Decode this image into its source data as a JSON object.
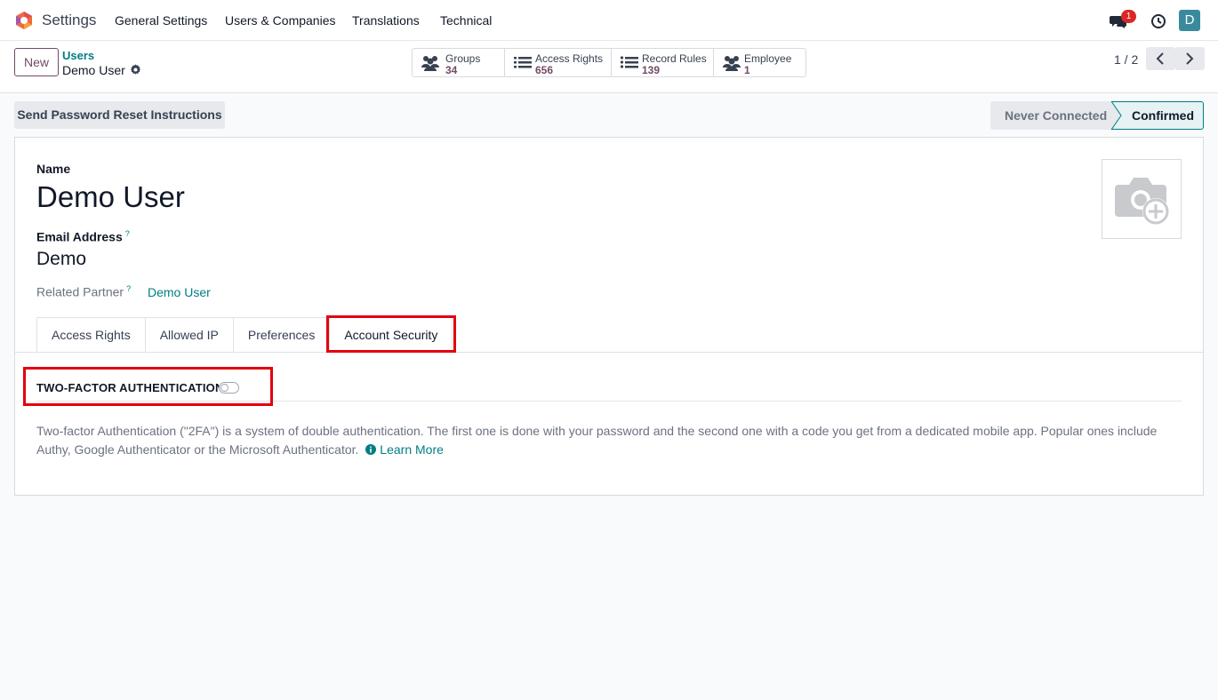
{
  "navbar": {
    "app_title": "Settings",
    "menu": [
      "General Settings",
      "Users & Companies",
      "Translations",
      "Technical"
    ],
    "notification_count": "1",
    "avatar_letter": "D"
  },
  "control_panel": {
    "new_label": "New",
    "breadcrumb_parent": "Users",
    "breadcrumb_current": "Demo User",
    "smart_buttons": [
      {
        "label": "Groups",
        "value": "34",
        "icon": "users-icon"
      },
      {
        "label": "Access Rights",
        "value": "656",
        "icon": "list-icon"
      },
      {
        "label": "Record Rules",
        "value": "139",
        "icon": "list-icon"
      },
      {
        "label": "Employee",
        "value": "1",
        "icon": "users-icon"
      }
    ],
    "pager": "1 / 2"
  },
  "statusbar": {
    "reset_button": "Send Password Reset Instructions",
    "stages": [
      "Never Connected",
      "Confirmed"
    ],
    "active_stage": "Confirmed"
  },
  "form": {
    "name_label": "Name",
    "name_value": "Demo User",
    "email_label": "Email Address",
    "email_help": "?",
    "email_value": "Demo",
    "partner_label": "Related Partner",
    "partner_help": "?",
    "partner_value": "Demo User",
    "tabs": [
      "Access Rights",
      "Allowed IP",
      "Preferences",
      "Account Security"
    ],
    "active_tab": "Account Security",
    "section_title": "TWO-FACTOR AUTHENTICATION",
    "two_factor_enabled": false,
    "description": "Two-factor Authentication (\"2FA\") is a system of double authentication. The first one is done with your password and the second one with a code you get from a dedicated mobile app. Popular ones include Authy, Google Authenticator or the Microsoft Authenticator.",
    "learn_more": "Learn More"
  },
  "colors": {
    "brand": "#714b67",
    "link": "#017e84",
    "highlight": "#e3000f"
  }
}
